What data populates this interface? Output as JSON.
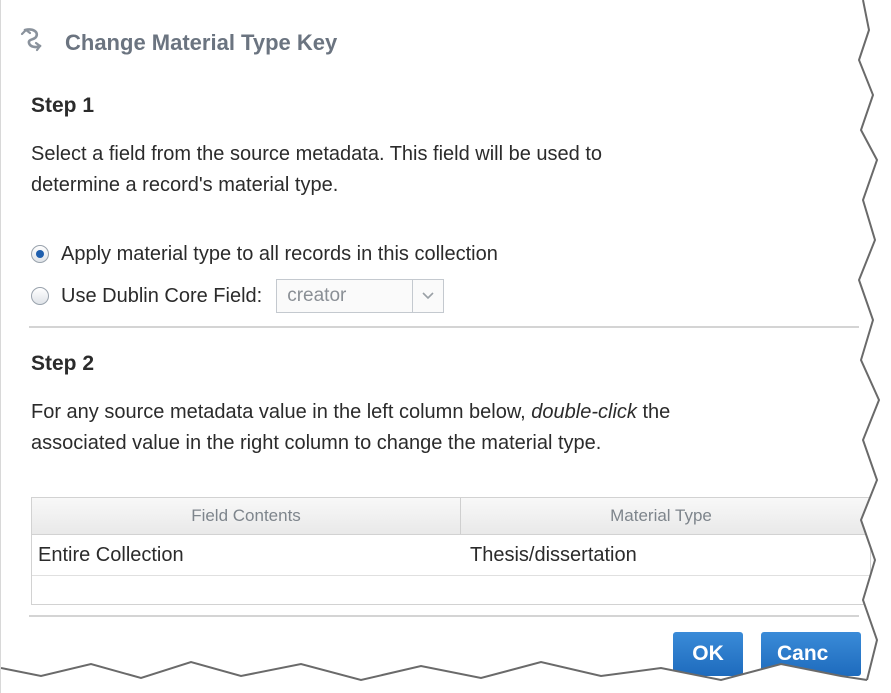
{
  "dialog": {
    "title": "Change Material Type Key"
  },
  "step1": {
    "title": "Step 1",
    "description_line1": "Select a field from the source metadata. This field will be used to",
    "description_line2": "determine a record's material type.",
    "option_all": "Apply material type to all records in this collection",
    "option_dc": "Use Dublin Core Field:",
    "dc_field_value": "creator",
    "selected_option": "option_all"
  },
  "step2": {
    "title": "Step 2",
    "description_pre": "For any source metadata value in the left column below, ",
    "description_em": "double-click",
    "description_post": " the",
    "description_line2": "associated value in the right column to change the material type."
  },
  "grid": {
    "columns": [
      "Field Contents",
      "Material Type"
    ],
    "rows": [
      {
        "field_contents": "Entire Collection",
        "material_type": "Thesis/dissertation"
      }
    ]
  },
  "buttons": {
    "ok": "OK",
    "cancel": "Canc"
  },
  "colors": {
    "accent": "#1e6bbd",
    "title": "#6b7480"
  },
  "icons": {
    "title": "material-type-key-icon",
    "dropdown": "chevron-down-icon"
  }
}
